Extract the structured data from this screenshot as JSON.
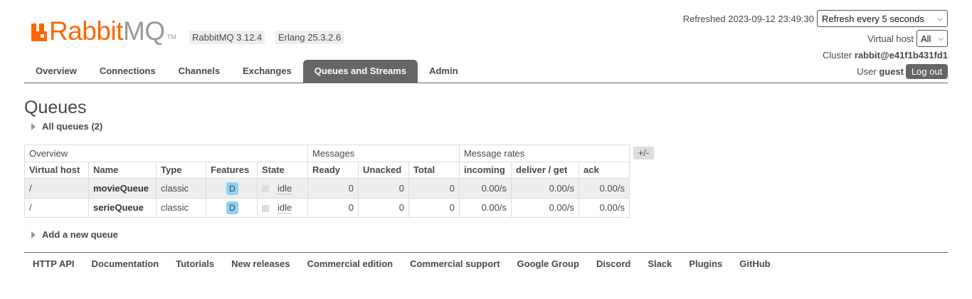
{
  "header": {
    "logo": {
      "word_primary": "Rabbit",
      "word_secondary": "MQ",
      "tm": "TM"
    },
    "versions": [
      "RabbitMQ 3.12.4",
      "Erlang 25.3.2.6"
    ],
    "refreshed": "Refreshed 2023-09-12 23:49:30",
    "refresh_select": "Refresh every 5 seconds",
    "vhost_label": "Virtual host",
    "vhost_select": "All",
    "cluster_label": "Cluster",
    "cluster_value": "rabbit@e41f1b431fd1",
    "user_label": "User",
    "user_value": "guest",
    "logout": "Log out"
  },
  "tabs": [
    {
      "label": "Overview",
      "active": false
    },
    {
      "label": "Connections",
      "active": false
    },
    {
      "label": "Channels",
      "active": false
    },
    {
      "label": "Exchanges",
      "active": false
    },
    {
      "label": "Queues and Streams",
      "active": true
    },
    {
      "label": "Admin",
      "active": false
    }
  ],
  "page": {
    "title": "Queues",
    "all_queues": "All queues (2)",
    "add_queue": "Add a new queue"
  },
  "table": {
    "groups": [
      "Overview",
      "Messages",
      "Message rates"
    ],
    "plus_minus": "+/-",
    "columns": [
      "Virtual host",
      "Name",
      "Type",
      "Features",
      "State",
      "Ready",
      "Unacked",
      "Total",
      "incoming",
      "deliver / get",
      "ack"
    ],
    "rows": [
      {
        "vhost": "/",
        "name": "movieQueue",
        "type": "classic",
        "feature": "D",
        "state": "idle",
        "ready": "0",
        "unacked": "0",
        "total": "0",
        "incoming": "0.00/s",
        "deliver_get": "0.00/s",
        "ack": "0.00/s"
      },
      {
        "vhost": "/",
        "name": "serieQueue",
        "type": "classic",
        "feature": "D",
        "state": "idle",
        "ready": "0",
        "unacked": "0",
        "total": "0",
        "incoming": "0.00/s",
        "deliver_get": "0.00/s",
        "ack": "0.00/s"
      }
    ]
  },
  "footer": [
    "HTTP API",
    "Documentation",
    "Tutorials",
    "New releases",
    "Commercial edition",
    "Commercial support",
    "Google Group",
    "Discord",
    "Slack",
    "Plugins",
    "GitHub"
  ],
  "colors": {
    "brand": "#ff6600",
    "tab_active": "#666666",
    "feature_badge": "#8ed3ef"
  }
}
